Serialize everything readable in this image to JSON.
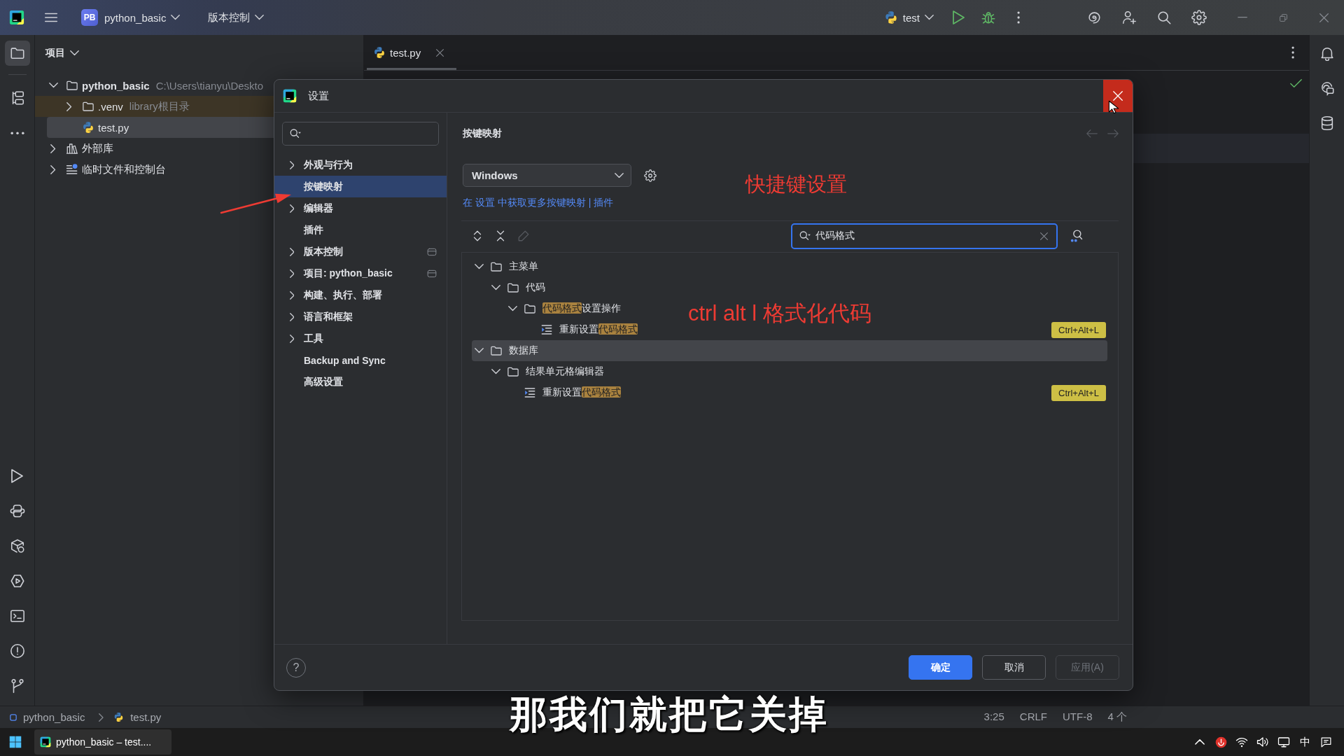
{
  "title_bar": {
    "project_badge": "PB",
    "project": "python_basic",
    "vcs_menu": "版本控制",
    "run_config": "test"
  },
  "tool_strip": [
    {
      "kind": "project",
      "selected": true
    },
    {
      "kind": "structure",
      "selected": false
    },
    {
      "kind": "more",
      "selected": false
    }
  ],
  "tool_strip_bottom": [
    {
      "kind": "run"
    },
    {
      "kind": "python-console"
    },
    {
      "kind": "packages"
    },
    {
      "kind": "services"
    },
    {
      "kind": "terminal"
    },
    {
      "kind": "problems"
    },
    {
      "kind": "git"
    }
  ],
  "project_panel": {
    "title": "项目",
    "tree": [
      {
        "kind": "project",
        "name": "python_basic",
        "hint": "C:\\Users\\tianyu\\Deskto",
        "expanded": true,
        "selected": false,
        "highlighted": false,
        "children": [
          {
            "kind": "folder",
            "name": ".venv",
            "hint": "library根目录",
            "expanded": false,
            "selected": false,
            "highlighted": true
          },
          {
            "kind": "python",
            "name": "test.py",
            "selected": true,
            "highlighted": false
          }
        ]
      },
      {
        "kind": "library",
        "name": "外部库",
        "expanded": false,
        "selected": false,
        "highlighted": false
      },
      {
        "kind": "scratch",
        "name": "临时文件和控制台",
        "expanded": false,
        "selected": false,
        "highlighted": false
      }
    ]
  },
  "editor": {
    "tabs": [
      {
        "label": "test.py",
        "selected": true
      }
    ]
  },
  "settings_dialog": {
    "title": "设置",
    "nav": [
      {
        "label": "外观与行为",
        "expandable": true,
        "selected": false,
        "badge": false
      },
      {
        "label": "按键映射",
        "expandable": false,
        "selected": true,
        "badge": false
      },
      {
        "label": "编辑器",
        "expandable": true,
        "selected": false,
        "badge": false
      },
      {
        "label": "插件",
        "expandable": false,
        "selected": false,
        "badge": false
      },
      {
        "label": "版本控制",
        "expandable": true,
        "selected": false,
        "badge": true
      },
      {
        "label": "项目: python_basic",
        "expandable": true,
        "selected": false,
        "badge": true
      },
      {
        "label": "构建、执行、部署",
        "expandable": true,
        "selected": false,
        "badge": false
      },
      {
        "label": "语言和框架",
        "expandable": true,
        "selected": false,
        "badge": false
      },
      {
        "label": "工具",
        "expandable": true,
        "selected": false,
        "badge": false
      },
      {
        "label": "Backup and Sync",
        "expandable": false,
        "selected": false,
        "badge": false
      },
      {
        "label": "高级设置",
        "expandable": false,
        "selected": false,
        "badge": false
      }
    ],
    "page_title": "按键映射",
    "history_buttons": [
      {
        "kind": "back",
        "disabled": true
      },
      {
        "kind": "forward",
        "disabled": true
      }
    ],
    "keymap": "Windows",
    "plugins_link": "在 设置 中获取更多按键映射 | 插件",
    "toolbar": [
      {
        "kind": "expand-all",
        "disabled": false
      },
      {
        "kind": "collapse-all",
        "disabled": false
      },
      {
        "kind": "edit",
        "disabled": true
      }
    ],
    "search": {
      "value": "代码格式"
    },
    "tree": [
      {
        "kind": "folder",
        "label": [
          {
            "text": "主菜单",
            "match": false
          }
        ],
        "expanded": true,
        "selected": false,
        "children": [
          {
            "kind": "folder",
            "label": [
              {
                "text": "代码",
                "match": false
              }
            ],
            "expanded": true,
            "selected": false,
            "children": [
              {
                "kind": "folder",
                "label": [
                  {
                    "text": "代码格式",
                    "match": true
                  },
                  {
                    "text": "设置操作",
                    "match": false
                  }
                ],
                "expanded": true,
                "selected": false,
                "children": [
                  {
                    "kind": "action",
                    "label": [
                      {
                        "text": "重新设置",
                        "match": false
                      },
                      {
                        "text": "代码格式",
                        "match": true
                      }
                    ],
                    "selected": false,
                    "shortcut": "Ctrl+Alt+L"
                  }
                ]
              }
            ]
          }
        ]
      },
      {
        "kind": "folder",
        "label": [
          {
            "text": "数据库",
            "match": false
          }
        ],
        "expanded": true,
        "selected": true,
        "children": [
          {
            "kind": "folder",
            "label": [
              {
                "text": "结果单元格编辑器",
                "match": false
              }
            ],
            "expanded": true,
            "selected": false,
            "children": [
              {
                "kind": "action",
                "label": [
                  {
                    "text": "重新设置",
                    "match": false
                  },
                  {
                    "text": "代码格式",
                    "match": true
                  }
                ],
                "selected": false,
                "shortcut": "Ctrl+Alt+L"
              }
            ]
          }
        ]
      }
    ],
    "help": "?",
    "buttons": [
      {
        "label": "确定",
        "kind": "primary",
        "disabled": false
      },
      {
        "label": "取消",
        "kind": "default",
        "disabled": false
      },
      {
        "label": "应用(A)",
        "kind": "default",
        "disabled": true
      }
    ]
  },
  "annotations": [
    {
      "text": "快捷键设置"
    },
    {
      "text": "ctrl alt l 格式化代码"
    }
  ],
  "subtitle": "那我们就把它关掉",
  "status_bar": {
    "breadcrumbs": [
      {
        "kind": "module",
        "label": "python_basic"
      },
      {
        "kind": "python",
        "label": "test.py"
      }
    ],
    "items": [
      "3:25",
      "CRLF",
      "UTF-8",
      "4 个"
    ]
  },
  "taskbar": {
    "apps": [
      {
        "label": "python_basic – test....",
        "selected": true
      }
    ],
    "ime": "中"
  }
}
